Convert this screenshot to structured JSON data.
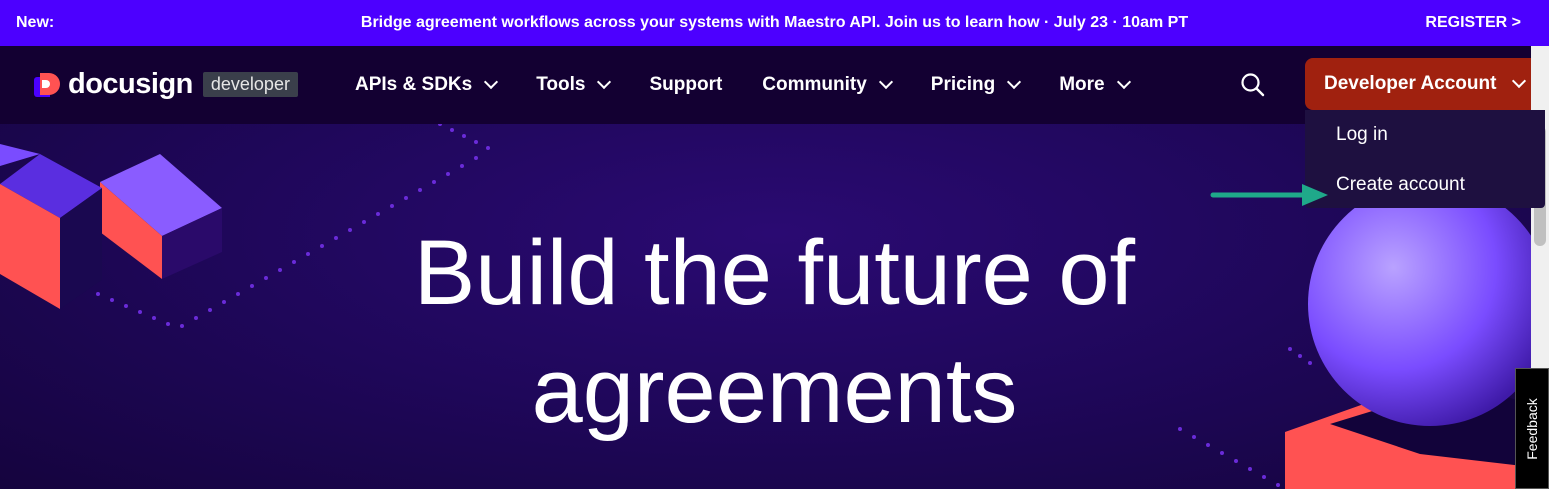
{
  "announcement": {
    "new_label": "New:",
    "message": "Bridge agreement workflows across your systems with Maestro API. Join us to learn how · July 23 · 10am PT",
    "register_label": "REGISTER >"
  },
  "nav": {
    "logo_text": "docusign",
    "logo_badge": "developer",
    "items": [
      {
        "label": "APIs & SDKs",
        "has_chevron": true
      },
      {
        "label": "Tools",
        "has_chevron": true
      },
      {
        "label": "Support",
        "has_chevron": false
      },
      {
        "label": "Community",
        "has_chevron": true
      },
      {
        "label": "Pricing",
        "has_chevron": true
      },
      {
        "label": "More",
        "has_chevron": true
      }
    ],
    "search_icon": "search-icon",
    "account_button": "Developer Account"
  },
  "dropdown": {
    "items": [
      "Log in",
      "Create account"
    ]
  },
  "hero": {
    "title_line1": "Build the future of",
    "title_line2": "agreements"
  },
  "feedback_label": "Feedback",
  "colors": {
    "announce_bg": "#4c00ff",
    "nav_bg": "#130032",
    "account_button_bg": "#a0210f",
    "arrow": "#1fa98a",
    "hero_bg": "#1f075a"
  }
}
